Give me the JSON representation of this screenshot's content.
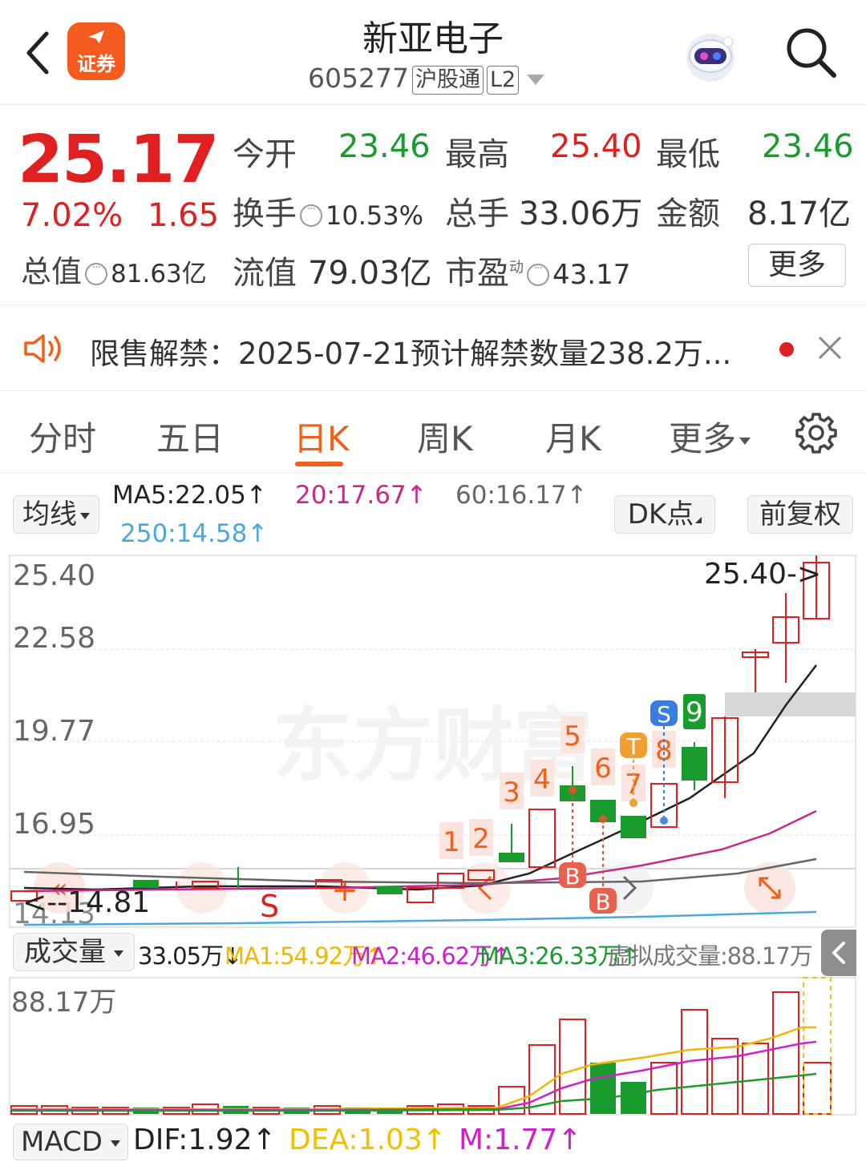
{
  "header": {
    "title": "新亚电子",
    "code": "605277",
    "tag_hgt": "沪股通",
    "tag_l2": "L2",
    "logo_text": "证券"
  },
  "quote": {
    "price": "25.17",
    "change_pct": "7.02%",
    "change": "1.65",
    "open_label": "今开",
    "open": "23.46",
    "high_label": "最高",
    "high": "25.40",
    "low_label": "最低",
    "low": "23.46",
    "turnover_label": "换手",
    "turnover": "10.53%",
    "volume_label": "总手",
    "volume": "33.06万",
    "amount_label": "金额",
    "amount": "8.17亿",
    "mcap_label": "总值",
    "mcap": "81.63亿",
    "float_label": "流值",
    "float_mcap": "79.03亿",
    "pe_label": "市盈",
    "pe_sup": "动",
    "pe": "43.17",
    "more_label": "更多"
  },
  "notice": {
    "text": "限售解禁：2025-07-21预计解禁数量238.2万..."
  },
  "tabs": [
    "分时",
    "五日",
    "日K",
    "周K",
    "月K",
    "更多"
  ],
  "active_tab": "日K",
  "ma_bar": {
    "selector": "均线",
    "ma5": "MA5:22.05↑",
    "ma20": "20:17.67↑",
    "ma60": "60:16.17↑",
    "ma250": "250:14.58↑",
    "dk_label": "DK点",
    "fq_label": "前复权"
  },
  "kline": {
    "y_labels": [
      "25.40",
      "22.58",
      "19.77",
      "16.95",
      "14.13"
    ],
    "max_label": "25.40->",
    "min_label": "<--14.81",
    "watermark": "东方财富",
    "signals": [
      "1",
      "2",
      "3",
      "4",
      "5",
      "6",
      "7",
      "8",
      "9"
    ],
    "marker_s": "S",
    "marker_b": "B",
    "marker_t": "T"
  },
  "volume_bar": {
    "selector": "成交量",
    "current": "33.05万↓",
    "ma1": "MA1:54.92万↑",
    "ma2": "MA2:46.62万↑",
    "ma3": "MA3:26.33万↑",
    "virtual": "虚拟成交量:88.17万",
    "y_max": "88.17万"
  },
  "macd_bar": {
    "selector": "MACD",
    "dif": "DIF:1.92↑",
    "dea": "DEA:1.03↑",
    "m": "M:1.77↑"
  },
  "colors": {
    "up": "#e02020",
    "down": "#1a9b2e",
    "accent": "#f0601a",
    "ma5": "#222222",
    "ma20": "#c8288c",
    "ma60": "#666666",
    "ma250": "#4aa8e0",
    "vma1": "#f0b800",
    "vma2": "#d020c8",
    "vma3": "#1a9b2e"
  }
}
